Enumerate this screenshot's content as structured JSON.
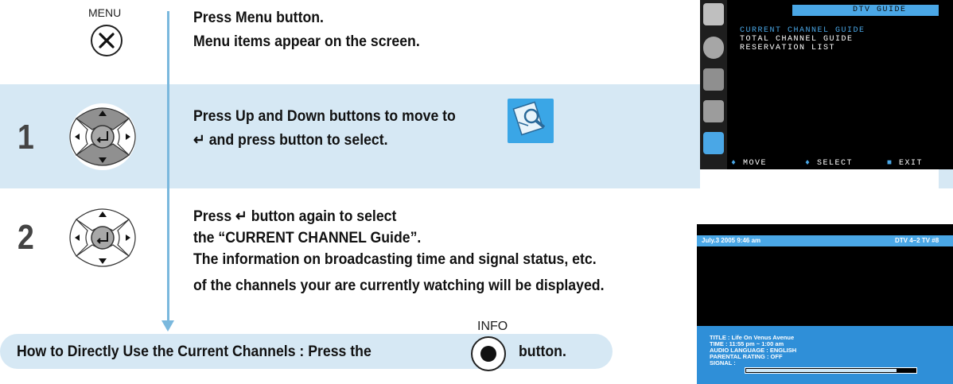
{
  "menu": {
    "button_label": "MENU",
    "title": "Press Menu button.",
    "desc": "Menu items appear on the screen."
  },
  "step1": {
    "number": "1",
    "line1": "Press Up and Down buttons to move to",
    "enter_symbol": "↵",
    "line2": " and press button to select."
  },
  "step2": {
    "number": "2",
    "line1_pre": "Press ",
    "enter_symbol": "↵",
    "line1_post": " button again to select",
    "line2": "the “CURRENT CHANNEL Guide”.",
    "line3": "The information on broadcasting time and signal status, etc.",
    "line4": "of the channels your are currently watching will be displayed."
  },
  "direct": {
    "text_pre": "How to Directly Use the Current Channels : Press the",
    "text_post": "button.",
    "info_label": "INFO"
  },
  "tv1": {
    "header": "DTV GUIDE",
    "items": [
      "CURRENT CHANNEL GUIDE",
      "TOTAL CHANNEL GUIDE",
      "RESERVATION LIST"
    ],
    "footer_move": "MOVE",
    "footer_select": "SELECT",
    "footer_exit": "EXIT"
  },
  "tv2": {
    "date": "July.3 2005 9:46 am",
    "channel": "DTV 4–2 TV #8",
    "title": "TITLE : Life On Venus Avenue",
    "time": "TIME : 11:55 pm ~ 1:00 am",
    "audio": "AUDIO LANGUAGE : ENGLISH",
    "parental": "PARENTAL RATING : OFF",
    "signal": "SIGNAL :",
    "signal_level": 0.88
  },
  "colors": {
    "band": "#d6e8f4",
    "line": "#7ab8dd",
    "tv_bar": "#4aa7e6",
    "tv_highlight": "#2f8fd8"
  }
}
